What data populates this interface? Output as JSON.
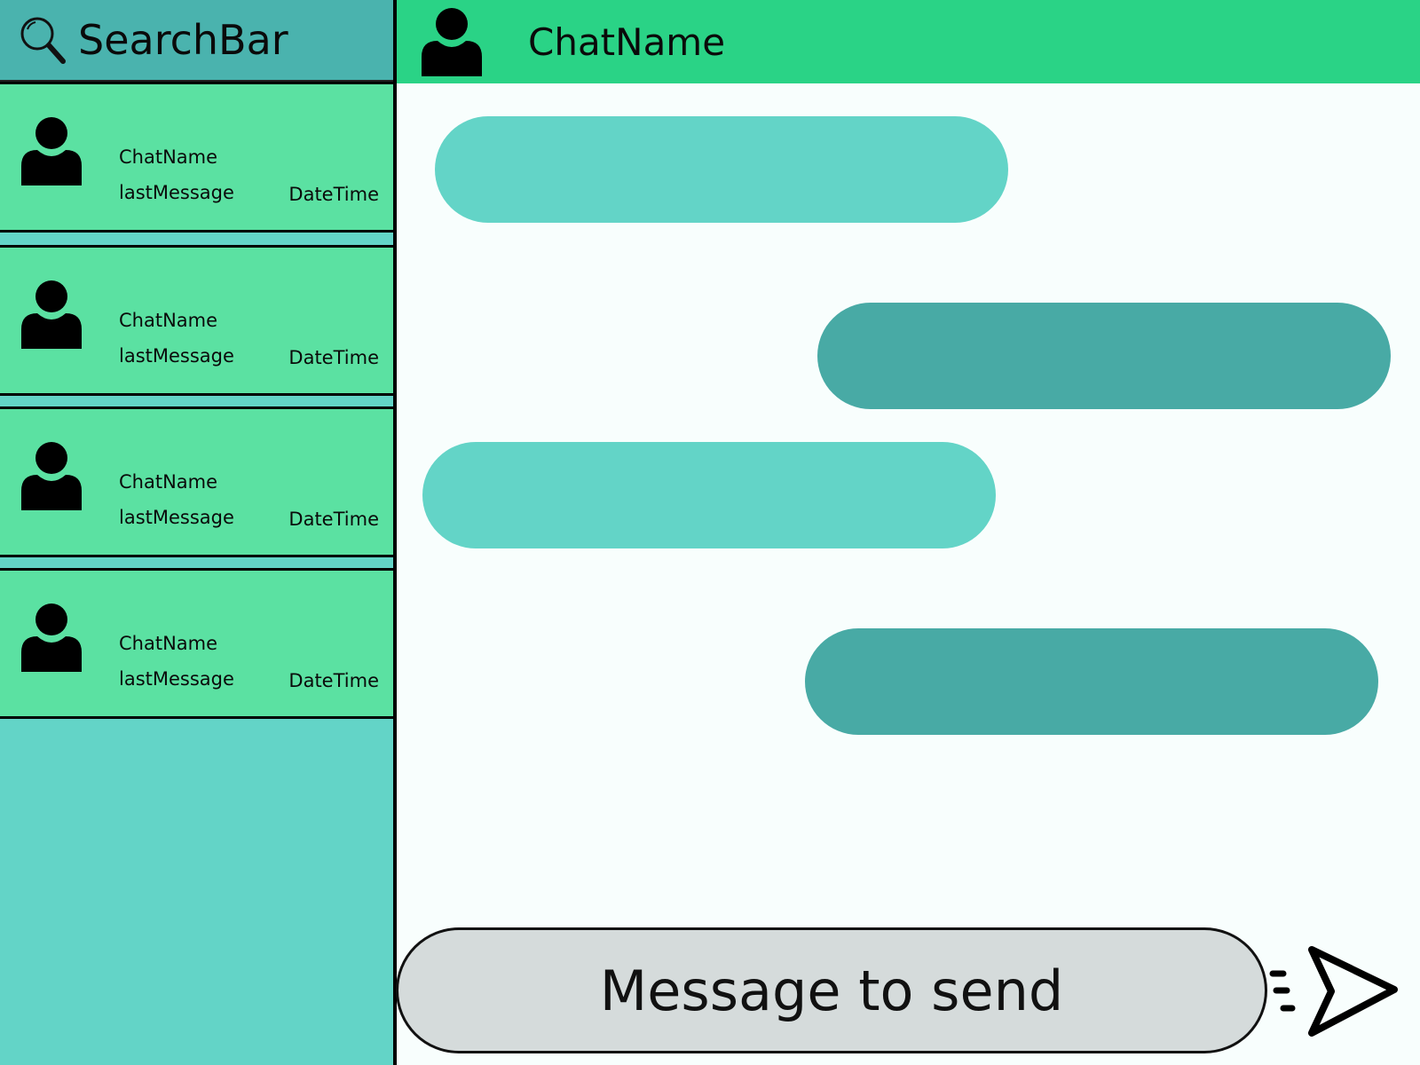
{
  "sidebar": {
    "search": {
      "label": "SearchBar",
      "icon": "search-icon"
    },
    "chats": [
      {
        "name": "ChatName",
        "last_message": "lastMessage",
        "date_time": "DateTime",
        "icon": "user-avatar-icon"
      },
      {
        "name": "ChatName",
        "last_message": "lastMessage",
        "date_time": "DateTime",
        "icon": "user-avatar-icon"
      },
      {
        "name": "ChatName",
        "last_message": "lastMessage",
        "date_time": "DateTime",
        "icon": "user-avatar-icon"
      },
      {
        "name": "ChatName",
        "last_message": "lastMessage",
        "date_time": "DateTime",
        "icon": "user-avatar-icon"
      }
    ]
  },
  "header": {
    "chat_name": "ChatName",
    "icon": "user-avatar-icon"
  },
  "messages": [
    {
      "direction": "received"
    },
    {
      "direction": "sent"
    },
    {
      "direction": "received"
    },
    {
      "direction": "sent"
    }
  ],
  "composer": {
    "placeholder": "Message to send",
    "send_icon": "send-icon"
  },
  "colors": {
    "sidebar_bg": "#63d4c7",
    "search_bar_bg": "#4ab3ae",
    "chat_item_bg": "#5be1a2",
    "header_bg": "#2ad386",
    "received_bubble": "#63d4c7",
    "sent_bubble": "#48aaa5",
    "composer_bg": "#d5dbdb",
    "chat_bg": "#f8fefd"
  }
}
